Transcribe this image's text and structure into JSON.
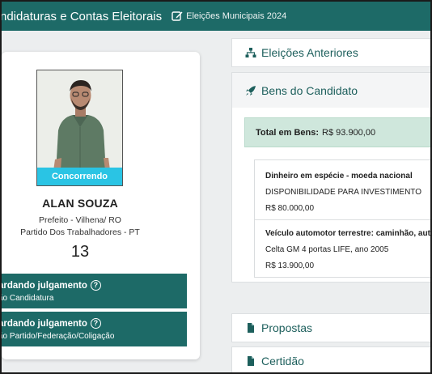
{
  "header": {
    "title": "ndidaturas e Contas Eleitorais",
    "subtitle": "Eleições Municipais 2024",
    "edit_icon": "edit-icon"
  },
  "candidate": {
    "status_badge": "Concorrendo",
    "name": "ALAN SOUZA",
    "office": "Prefeito - Vilhena/ RO",
    "party": "Partido Dos Trabalhadores - PT",
    "number": "13"
  },
  "status_items": [
    {
      "title": "ardando julgamento",
      "subtitle": "ão Candidatura"
    },
    {
      "title": "ardando julgamento",
      "subtitle": "ão Partido/Federação/Coligação"
    }
  ],
  "sections": {
    "eleicoes_anteriores": "Eleições Anteriores",
    "bens": "Bens do Candidato",
    "propostas": "Propostas",
    "certidao": "Certidão"
  },
  "bens": {
    "total_label": "Total em Bens:",
    "total_value": "R$ 93.900,00",
    "items": [
      {
        "type": "Dinheiro em espécie - moeda nacional",
        "description": "DISPONIBILIDADE PARA INVESTIMENTO",
        "value": "R$ 80.000,00"
      },
      {
        "type": "Veículo automotor terrestre: caminhão, autom",
        "description": "Celta GM 4 portas LIFE, ano 2005",
        "value": "R$ 13.900,00"
      }
    ]
  },
  "colors": {
    "primary": "#1d6a67",
    "badge": "#2ac4e4",
    "total_bg": "#cfe7dc"
  }
}
